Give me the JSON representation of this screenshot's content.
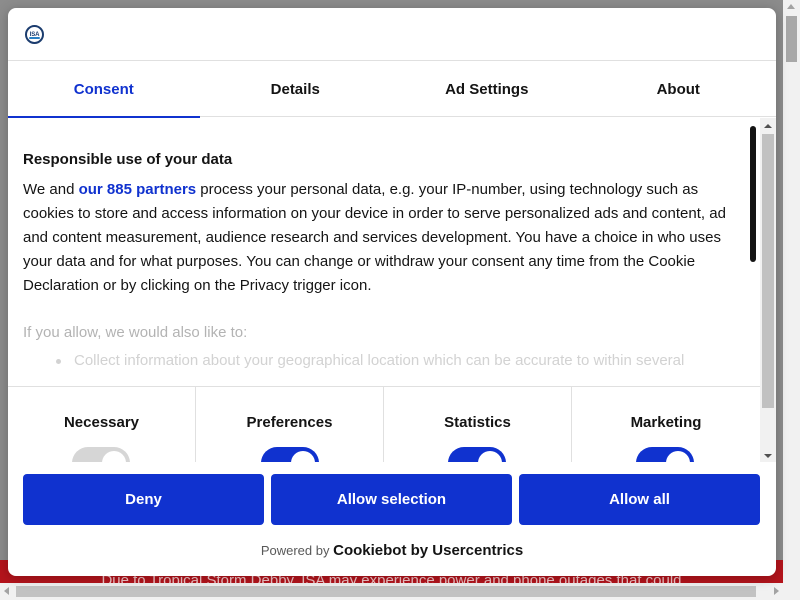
{
  "alert": {
    "text": "Due to Tropical Storm Debby, ISA may experience power and phone outages that could"
  },
  "dialog": {
    "logo_text": "ISA",
    "tabs": [
      {
        "label": "Consent",
        "active": true
      },
      {
        "label": "Details",
        "active": false
      },
      {
        "label": "Ad Settings",
        "active": false
      },
      {
        "label": "About",
        "active": false
      }
    ],
    "content": {
      "heading": "Responsible use of your data",
      "intro_before": "We and ",
      "partners_link": "our 885 partners",
      "intro_after": " process your personal data, e.g. your IP-number, using technology such as cookies to store and access information on your device in order to serve personalized ads and content, ad and content measurement, audience research and services development. You have a choice in who uses your data and for what purposes. You can change or withdraw your consent any time from the Cookie Declaration or by clicking on the Privacy trigger icon.",
      "also_like": "If you allow, we would also like to:",
      "list_item": "Collect information about your geographical location which can be accurate to within several"
    },
    "categories": [
      {
        "label": "Necessary",
        "enabled": false
      },
      {
        "label": "Preferences",
        "enabled": true
      },
      {
        "label": "Statistics",
        "enabled": true
      },
      {
        "label": "Marketing",
        "enabled": true
      }
    ],
    "buttons": {
      "deny": "Deny",
      "allow_selection": "Allow selection",
      "allow_all": "Allow all"
    },
    "powered_by": "Powered by",
    "powered_brand": "Cookiebot by Usercentrics"
  },
  "colors": {
    "accent": "#1032cf",
    "alert_bg": "#b5141c",
    "text": "#141414"
  }
}
